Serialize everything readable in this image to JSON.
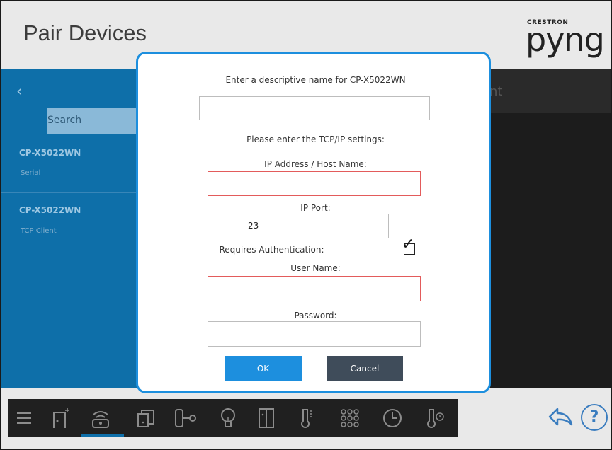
{
  "header": {
    "title": "Pair Devices",
    "logo_small": "CRESTRON",
    "logo_big": "pyng"
  },
  "panel": {
    "back_icon": "chevron-left-icon",
    "search_label": "Search",
    "behind_title_fragment": "nt",
    "devices": [
      {
        "name": "CP-X5022WN",
        "type": "Serial"
      },
      {
        "name": "CP-X5022WN",
        "type": "TCP Client"
      }
    ]
  },
  "dialog": {
    "name_prompt": "Enter a descriptive name for CP-X5022WN",
    "name_value": "",
    "tcp_prompt": "Please enter the TCP/IP settings:",
    "ip_label": "IP Address / Host Name:",
    "ip_value": "",
    "port_label": "IP Port:",
    "port_value": "23",
    "auth_label": "Requires Authentication:",
    "auth_checked": true,
    "user_label": "User Name:",
    "user_value": "",
    "password_label": "Password:",
    "password_value": "",
    "ok_label": "OK",
    "cancel_label": "Cancel"
  },
  "toolbar": {
    "icons": [
      "menu-icon",
      "room-add-icon",
      "remote-icon",
      "copy-icon",
      "flow-icon",
      "bulb-icon",
      "panel-icon",
      "thermometer-icon",
      "grid-dots-icon",
      "clock-icon",
      "thermostat-icon"
    ],
    "selected": "remote-icon"
  },
  "footer": {
    "back_icon": "return-arrow-icon",
    "help_label": "?"
  },
  "colors": {
    "accent": "#1d8fde",
    "panel_blue": "#0e6fa9",
    "error_border": "#e35b5b",
    "cancel_button": "#3f4c5a"
  }
}
